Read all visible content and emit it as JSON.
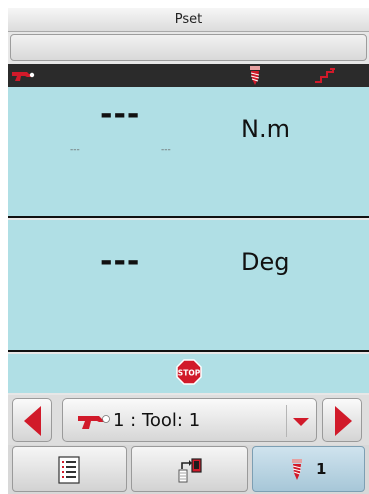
{
  "window": {
    "title": "Pset"
  },
  "status_strip": {
    "left_icon": "tool-gun-icon",
    "center_icon": "screw-icon",
    "right_icon": "step-graph-icon"
  },
  "torque": {
    "value": "---",
    "unit": "N.m",
    "min_value": "---",
    "max_value": "---"
  },
  "angle": {
    "value": "---",
    "unit": "Deg"
  },
  "stop": {
    "icon": "stop-sign-icon",
    "label": "STOP"
  },
  "tool_selector": {
    "label": "1 : Tool: 1",
    "icon": "tool-gun-icon"
  },
  "tabs": [
    {
      "name": "results-list",
      "icon": "list-icon"
    },
    {
      "name": "transfer",
      "icon": "transfer-icon"
    },
    {
      "name": "screw-count",
      "icon": "screw-icon",
      "count": "1"
    }
  ],
  "colors": {
    "panel_bg": "#b0dfe5",
    "accent_red": "#d11a2a",
    "status_strip_bg": "#2b2b2b"
  }
}
